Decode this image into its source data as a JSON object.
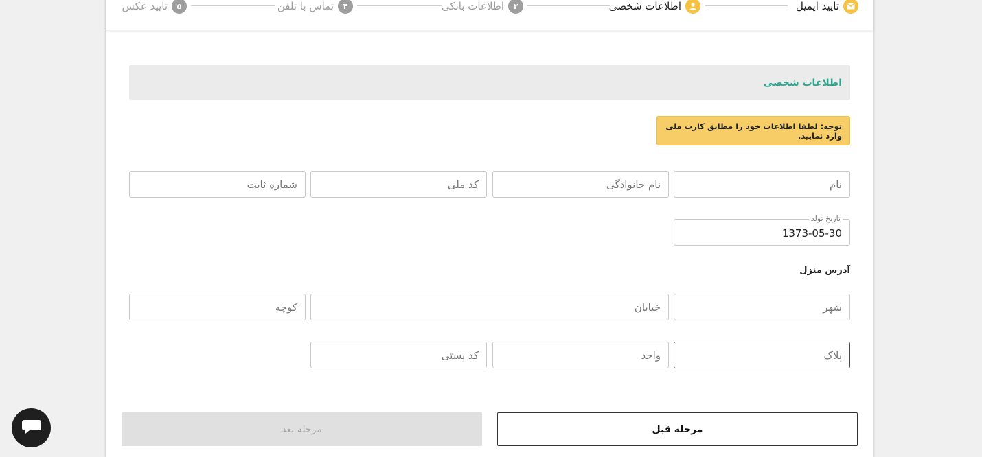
{
  "stepper": {
    "steps": [
      {
        "number": "",
        "label": "تایید ایمیل",
        "state": "active",
        "icon": "envelope-icon"
      },
      {
        "number": "",
        "label": "اطلاعات شخصی",
        "state": "active",
        "icon": "user-icon"
      },
      {
        "number": "۳",
        "label": "اطلاعات بانکی",
        "state": "todo"
      },
      {
        "number": "۴",
        "label": "تماس با تلفن",
        "state": "todo"
      },
      {
        "number": "۵",
        "label": "تایید عکس",
        "state": "todo"
      }
    ]
  },
  "section": {
    "title": "اطلاعات شخصی",
    "notice": "توجه: لطفا اطلاعات خود را مطابق کارت ملی وارد نمایید."
  },
  "fields": {
    "first_name": {
      "placeholder": "نام",
      "value": ""
    },
    "last_name": {
      "placeholder": "نام خانوادگی",
      "value": ""
    },
    "national_code": {
      "placeholder": "کد ملی",
      "value": ""
    },
    "landline": {
      "placeholder": "شماره ثابت",
      "value": ""
    },
    "birth_date": {
      "label": "تاریخ تولد",
      "value": "1373-05-30"
    }
  },
  "address": {
    "label": "آدرس منزل",
    "city": {
      "placeholder": "شهر",
      "value": ""
    },
    "street": {
      "placeholder": "خیابان",
      "value": ""
    },
    "alley": {
      "placeholder": "کوچه",
      "value": ""
    },
    "plaque": {
      "placeholder": "پلاک",
      "value": ""
    },
    "unit": {
      "placeholder": "واحد",
      "value": ""
    },
    "postal_code": {
      "placeholder": "کد پستی",
      "value": ""
    }
  },
  "buttons": {
    "prev": "مرحله قبل",
    "next": "مرحله بعد"
  },
  "colors": {
    "accent": "#2aa68e",
    "step_active": "#f5c242",
    "notice_bg": "#f7cd67"
  },
  "chat": {
    "icon": "chat-bubble-icon"
  }
}
